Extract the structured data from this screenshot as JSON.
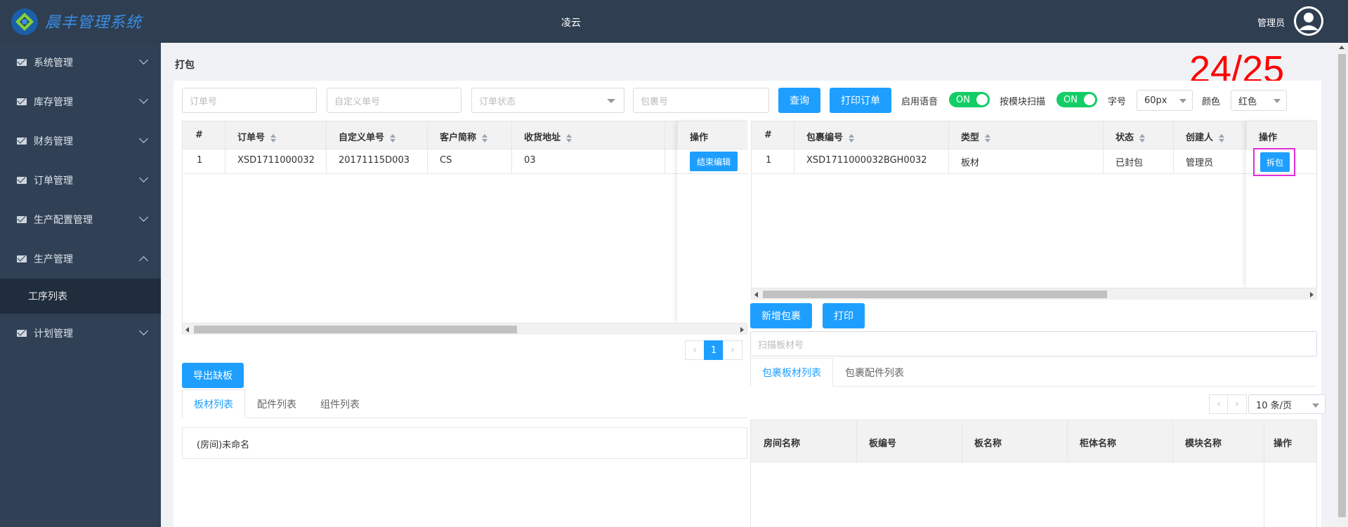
{
  "header": {
    "brand": "晨丰管理系统",
    "center_title": "凌云",
    "user_label": "管理员"
  },
  "sidebar": {
    "items": [
      {
        "label": "系统管理",
        "expanded": false
      },
      {
        "label": "库存管理",
        "expanded": false
      },
      {
        "label": "财务管理",
        "expanded": false
      },
      {
        "label": "订单管理",
        "expanded": false
      },
      {
        "label": "生产配置管理",
        "expanded": false
      },
      {
        "label": "生产管理",
        "expanded": true
      },
      {
        "label": "计划管理",
        "expanded": false
      }
    ],
    "submenu": {
      "label": "工序列表"
    }
  },
  "page": {
    "title": "打包",
    "counter": "24/25"
  },
  "toolbar": {
    "order_no_placeholder": "订单号",
    "custom_no_placeholder": "自定义单号",
    "order_status_placeholder": "订单状态",
    "package_no_placeholder": "包裹号",
    "query_label": "查询",
    "print_order_label": "打印订单",
    "voice_label": "启用语音",
    "voice_switch": "ON",
    "module_scan_label": "按模块扫描",
    "module_scan_switch": "ON",
    "font_size_label": "字号",
    "font_size_value": "60px",
    "color_label": "颜色",
    "color_value": "红色"
  },
  "orders_table": {
    "headers": [
      "#",
      "订单号",
      "自定义单号",
      "客户简称",
      "收货地址",
      "操作"
    ],
    "rows": [
      {
        "idx": "1",
        "order_no": "XSD1711000032",
        "custom_no": "20171115D003",
        "customer": "CS",
        "address": "03",
        "action": "结束编辑"
      }
    ],
    "pager": {
      "current": "1"
    }
  },
  "packages_table": {
    "headers": [
      "#",
      "包裹编号",
      "类型",
      "状态",
      "创建人",
      "操作"
    ],
    "rows": [
      {
        "idx": "1",
        "package_no": "XSD1711000032BGH0032",
        "type": "板材",
        "status": "已封包",
        "creator": "管理员",
        "action": "拆包"
      }
    ]
  },
  "package_actions": {
    "add_label": "新增包裹",
    "print_label": "打印",
    "scan_placeholder": "扫描板材号"
  },
  "export_button": "导出缺板",
  "left_tabs": {
    "items": [
      "板材列表",
      "配件列表",
      "组件列表"
    ],
    "active": 0,
    "room_text": "(房间)未命名"
  },
  "right_tabs": {
    "items": [
      "包裹板材列表",
      "包裹配件列表"
    ],
    "active": 0,
    "page_size": "10 条/页"
  },
  "board_table": {
    "headers": [
      "房间名称",
      "板编号",
      "板名称",
      "柜体名称",
      "模块名称",
      "操作"
    ]
  },
  "colors": {
    "topbar": "#2f3e50",
    "sidebar": "#304156",
    "primary": "#1e9fff",
    "switch_on": "#13ce66",
    "counter": "#ff0000",
    "highlight": "#e02cd9"
  }
}
